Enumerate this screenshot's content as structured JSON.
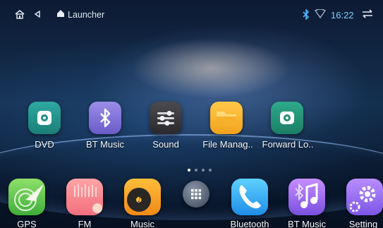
{
  "status_bar": {
    "app_title": "Launcher",
    "time": "16:22",
    "icons": [
      "home-icon",
      "back-icon",
      "launcher-icon",
      "bluetooth-icon",
      "wifi-icon",
      "return-icon"
    ]
  },
  "workspace_apps": [
    {
      "label": "DVD",
      "icon": "dvd-icon"
    },
    {
      "label": "BT Music",
      "icon": "bluetooth-icon"
    },
    {
      "label": "Sound",
      "icon": "equalizer-icon"
    },
    {
      "label": "File Manag..",
      "icon": "folder-icon"
    },
    {
      "label": "Forward Lo..",
      "icon": "camera-icon"
    }
  ],
  "page_indicator": {
    "count": 4,
    "active": 1
  },
  "dock": [
    {
      "label": "GPS",
      "icon": "gps-icon"
    },
    {
      "label": "FM",
      "icon": "radio-icon"
    },
    {
      "label": "Music",
      "icon": "music-icon"
    },
    {
      "label": "",
      "icon": "app-drawer-icon"
    },
    {
      "label": "Bluetooth",
      "icon": "phone-icon"
    },
    {
      "label": "BT Music",
      "icon": "bt-music-icon"
    },
    {
      "label": "Setting",
      "icon": "gear-icon"
    }
  ],
  "colors": {
    "time": "#7fd0ff",
    "bluetooth": "#4fb4ff"
  }
}
